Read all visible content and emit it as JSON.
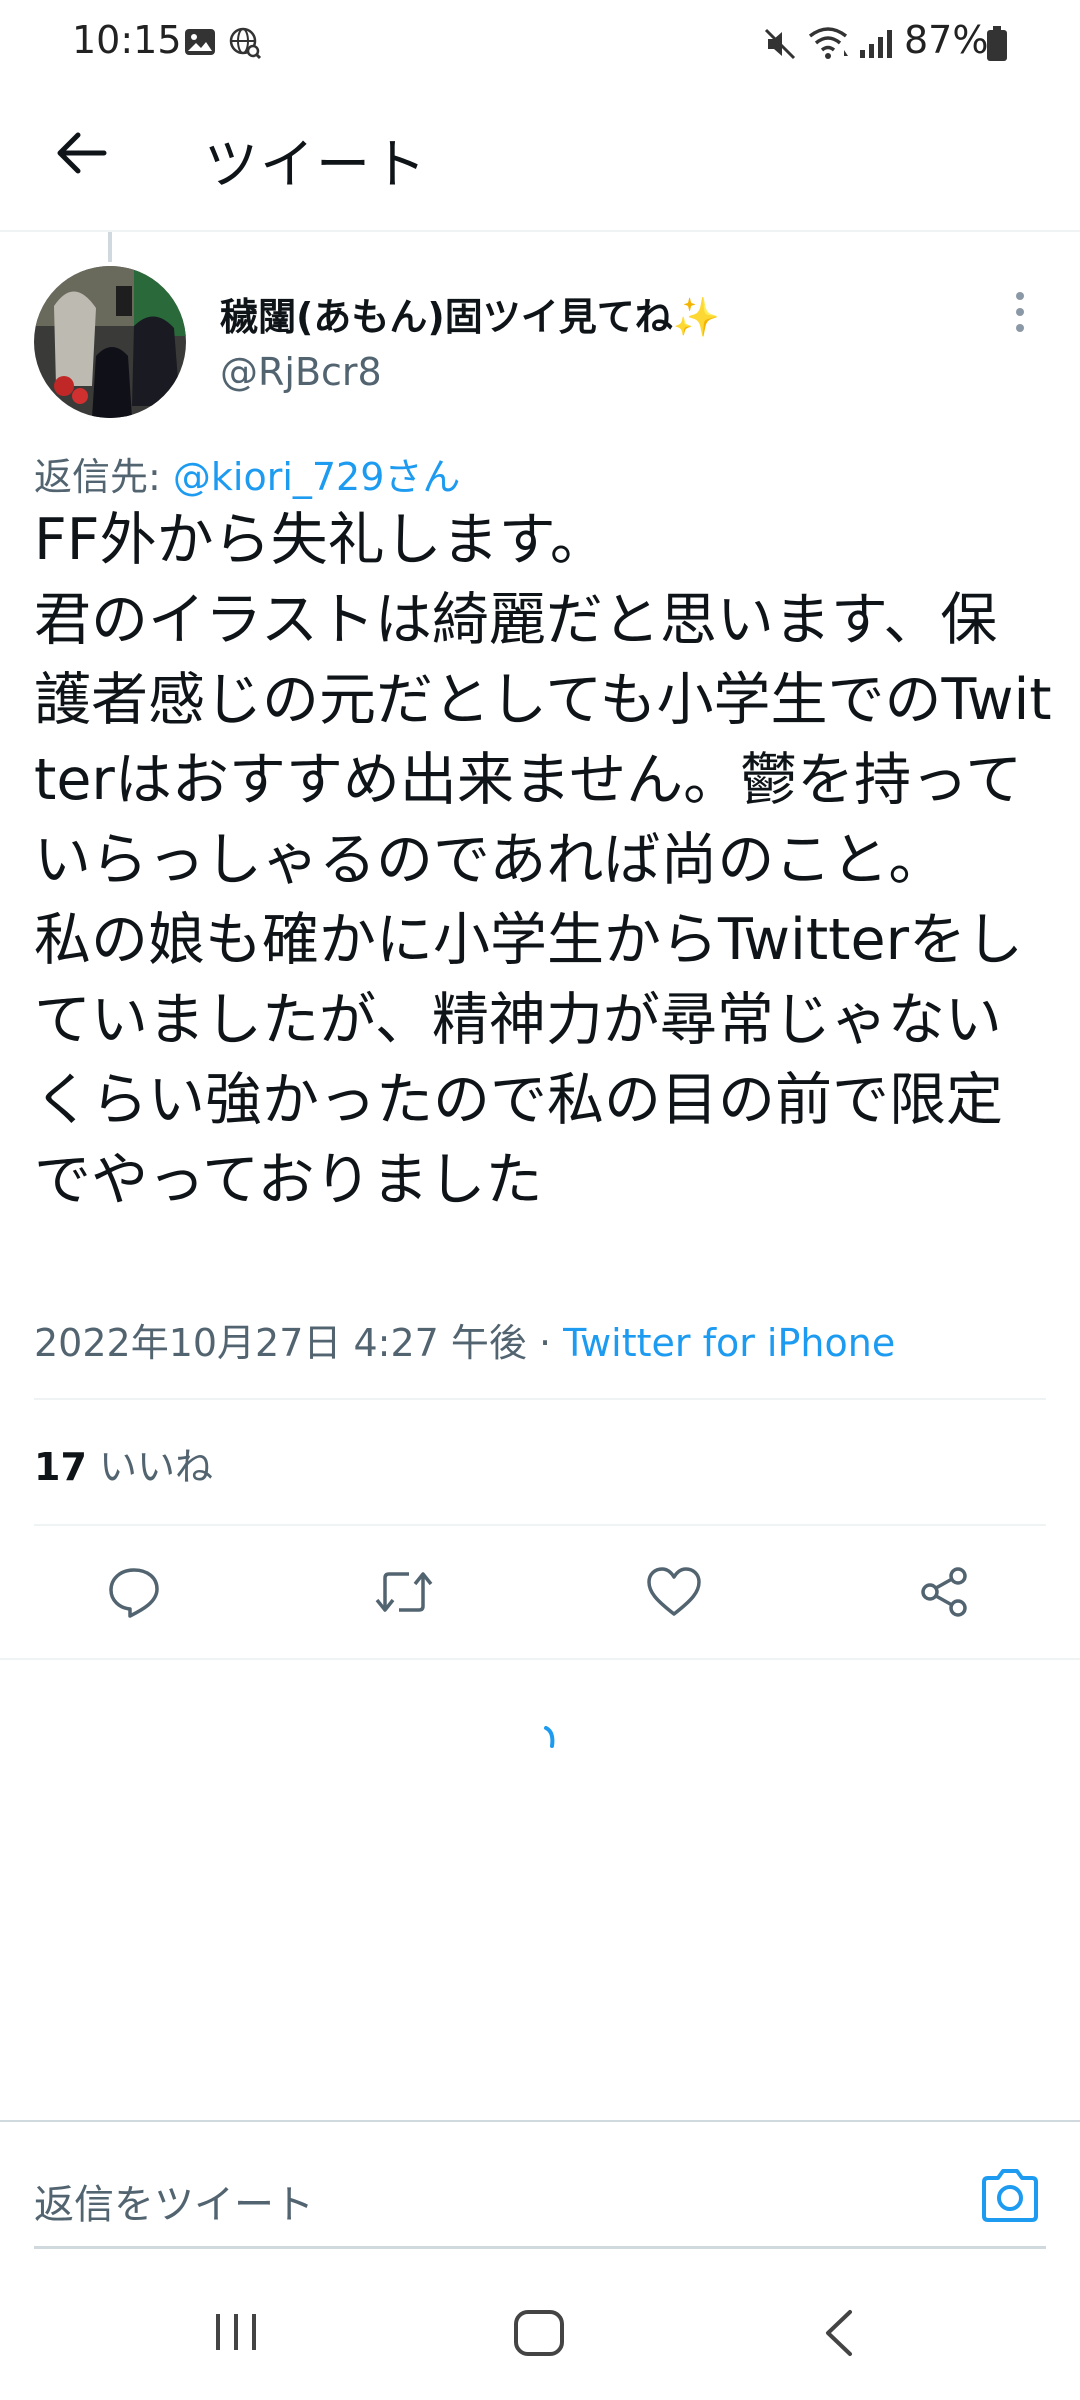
{
  "status_bar": {
    "time": "10:15",
    "battery": "87%",
    "icons": [
      "image-icon",
      "globe-search-icon",
      "mute-icon",
      "wifi-icon",
      "signal-icon",
      "battery-icon"
    ]
  },
  "header": {
    "title": "ツイート",
    "back_icon": "arrow-left-icon"
  },
  "tweet": {
    "display_name": "穢闥(あもん)固ツイ見てね✨",
    "handle": "@RjBcr8",
    "reply_prefix": "返信先: ",
    "reply_mention": "@kiori_729さん",
    "text": "FF外から失礼します。\n君のイラストは綺麗だと思います、保護者感じの元だとしても小学生でのTwitterはおすすめ出来ません。鬱を持っていらっしゃるのであれば尚のこと。\n私の娘も確かに小学生からTwitterをしていましたが、精神力が尋常じゃないくらい強かったので私の目の前で限定でやっておりました",
    "timestamp": "2022年10月27日 4:27 午後 · ",
    "source": "Twitter for iPhone",
    "likes_count": "17",
    "likes_label": " いいね"
  },
  "actions": [
    "reply-icon",
    "retweet-icon",
    "like-icon",
    "share-icon"
  ],
  "reply_bar": {
    "placeholder": "返信をツイート",
    "camera_icon": "camera-icon"
  },
  "nav_bar": [
    "recents-icon",
    "home-icon",
    "back-icon"
  ],
  "colors": {
    "accent": "#1d9bf0",
    "secondary_text": "#536471",
    "primary_text": "#0f1419",
    "divider": "#eff3f4"
  }
}
